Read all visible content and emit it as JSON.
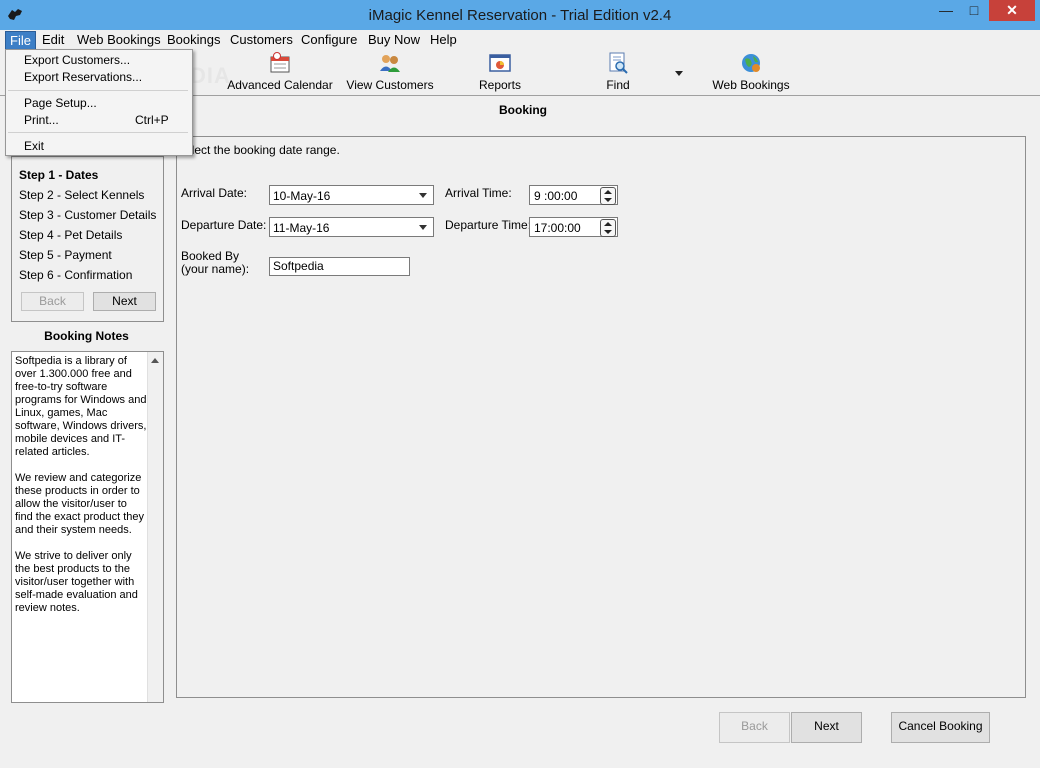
{
  "window": {
    "title": "iMagic Kennel Reservation - Trial Edition v2.4"
  },
  "menubar": {
    "items": [
      "File",
      "Edit",
      "Web Bookings",
      "Bookings",
      "Customers",
      "Configure",
      "Buy Now",
      "Help"
    ]
  },
  "file_menu": {
    "export_customers": "Export Customers...",
    "export_reservations": "Export Reservations...",
    "page_setup": "Page Setup...",
    "print": "Print...",
    "print_shortcut": "Ctrl+P",
    "exit": "Exit"
  },
  "toolbar": {
    "advanced_calendar": "Advanced Calendar",
    "view_customers": "View Customers",
    "reports": "Reports",
    "find": "Find",
    "web_bookings": "Web Bookings"
  },
  "header": {
    "title": "Booking"
  },
  "watermark": "SOFTPEDIA",
  "steps": {
    "items": [
      "Step 1 - Dates",
      "Step 2 - Select Kennels",
      "Step 3 - Customer Details",
      "Step 4 - Pet Details",
      "Step 5 - Payment",
      "Step 6 - Confirmation"
    ],
    "back": "Back",
    "next": "Next"
  },
  "notes": {
    "title": "Booking Notes",
    "text": "Softpedia is a library of over 1.300.000 free and free-to-try software programs for Windows and Linux, games, Mac software, Windows drivers, mobile devices and IT-related articles.\n\nWe review and categorize these products in order to allow the visitor/user to find the exact product they and their system needs.\n\nWe strive to deliver only the best products to the visitor/user together with self-made evaluation and review notes."
  },
  "form": {
    "instruction": "elect the booking date range.",
    "arrival_date_label": "Arrival Date:",
    "arrival_date_value": "10-May-16",
    "arrival_time_label": "Arrival Time:",
    "arrival_time_value": "9 :00:00",
    "departure_date_label": "Departure Date:",
    "departure_date_value": "11-May-16",
    "departure_time_label": "Departure Time:",
    "departure_time_value": "17:00:00",
    "booked_by_label": "Booked By (your name):",
    "booked_by_value": "Softpedia"
  },
  "footer": {
    "back": "Back",
    "next": "Next",
    "cancel": "Cancel Booking"
  }
}
